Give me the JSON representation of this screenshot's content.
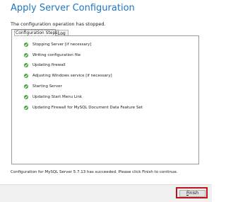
{
  "title": "Apply Server Configuration",
  "status_text": "The configuration operation has stopped.",
  "tabs": [
    {
      "label": "Configuration Steps",
      "active": true
    },
    {
      "label": "Log",
      "active": false
    }
  ],
  "steps": [
    {
      "label": "Stopping Server [if necessary]",
      "status": "done"
    },
    {
      "label": "Writing configuration file",
      "status": "done"
    },
    {
      "label": "Updating firewall",
      "status": "done"
    },
    {
      "label": "Adjusting Windows service [if necessary]",
      "status": "done"
    },
    {
      "label": "Starting Server",
      "status": "done"
    },
    {
      "label": "Updating Start Menu Link",
      "status": "done"
    },
    {
      "label": "Updating Firewall for MySQL Document Data Feature Set",
      "status": "done"
    }
  ],
  "success_message": "Configuration for MySQL Server 5.7.13 has succeeded.  Please click Finish to continue.",
  "footer": {
    "finish_label_mnemonic": "F",
    "finish_label_rest": "inish"
  },
  "colors": {
    "title": "#1e75c4",
    "check": "#46a53a",
    "highlight": "#c0141c"
  },
  "icons": {
    "step_status": "check-circle-icon"
  }
}
